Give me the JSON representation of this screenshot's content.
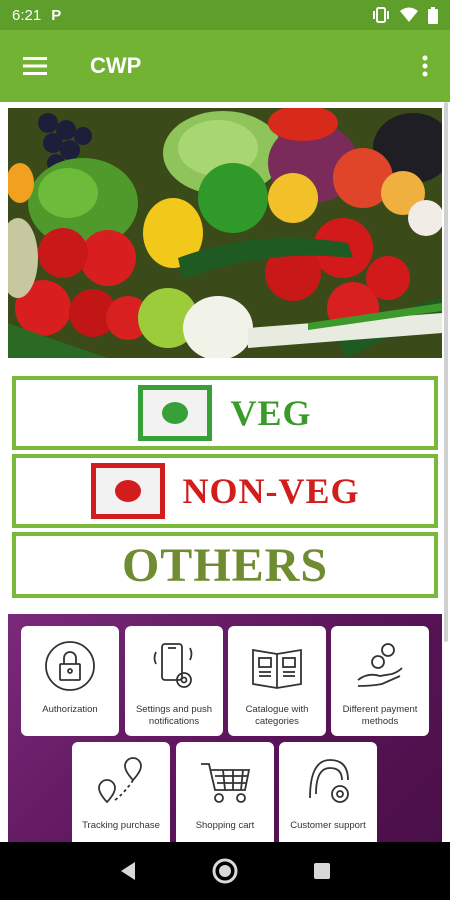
{
  "status_bar": {
    "time": "6:21",
    "app_letter": "P"
  },
  "app_bar": {
    "title": "CWP"
  },
  "categories": [
    {
      "label": "VEG"
    },
    {
      "label": "NON-VEG"
    },
    {
      "label": "OTHERS"
    }
  ],
  "features": [
    {
      "label": "Authorization",
      "icon": "lock-icon"
    },
    {
      "label": "Settings and push notifications",
      "icon": "phone-settings-icon"
    },
    {
      "label": "Catalogue with categories",
      "icon": "book-icon"
    },
    {
      "label": "Different payment methods",
      "icon": "coins-hand-icon"
    },
    {
      "label": "Tracking purchase",
      "icon": "location-tracking-icon"
    },
    {
      "label": "Shopping cart",
      "icon": "cart-icon"
    },
    {
      "label": "Customer support",
      "icon": "support-icon"
    }
  ],
  "colors": {
    "status_bar": "#5e9e2b",
    "app_bar": "#72b334",
    "veg": "#3a9a2a",
    "nonveg": "#d21d1d",
    "others": "#6f8c31",
    "features_bg": "#5a1458"
  }
}
